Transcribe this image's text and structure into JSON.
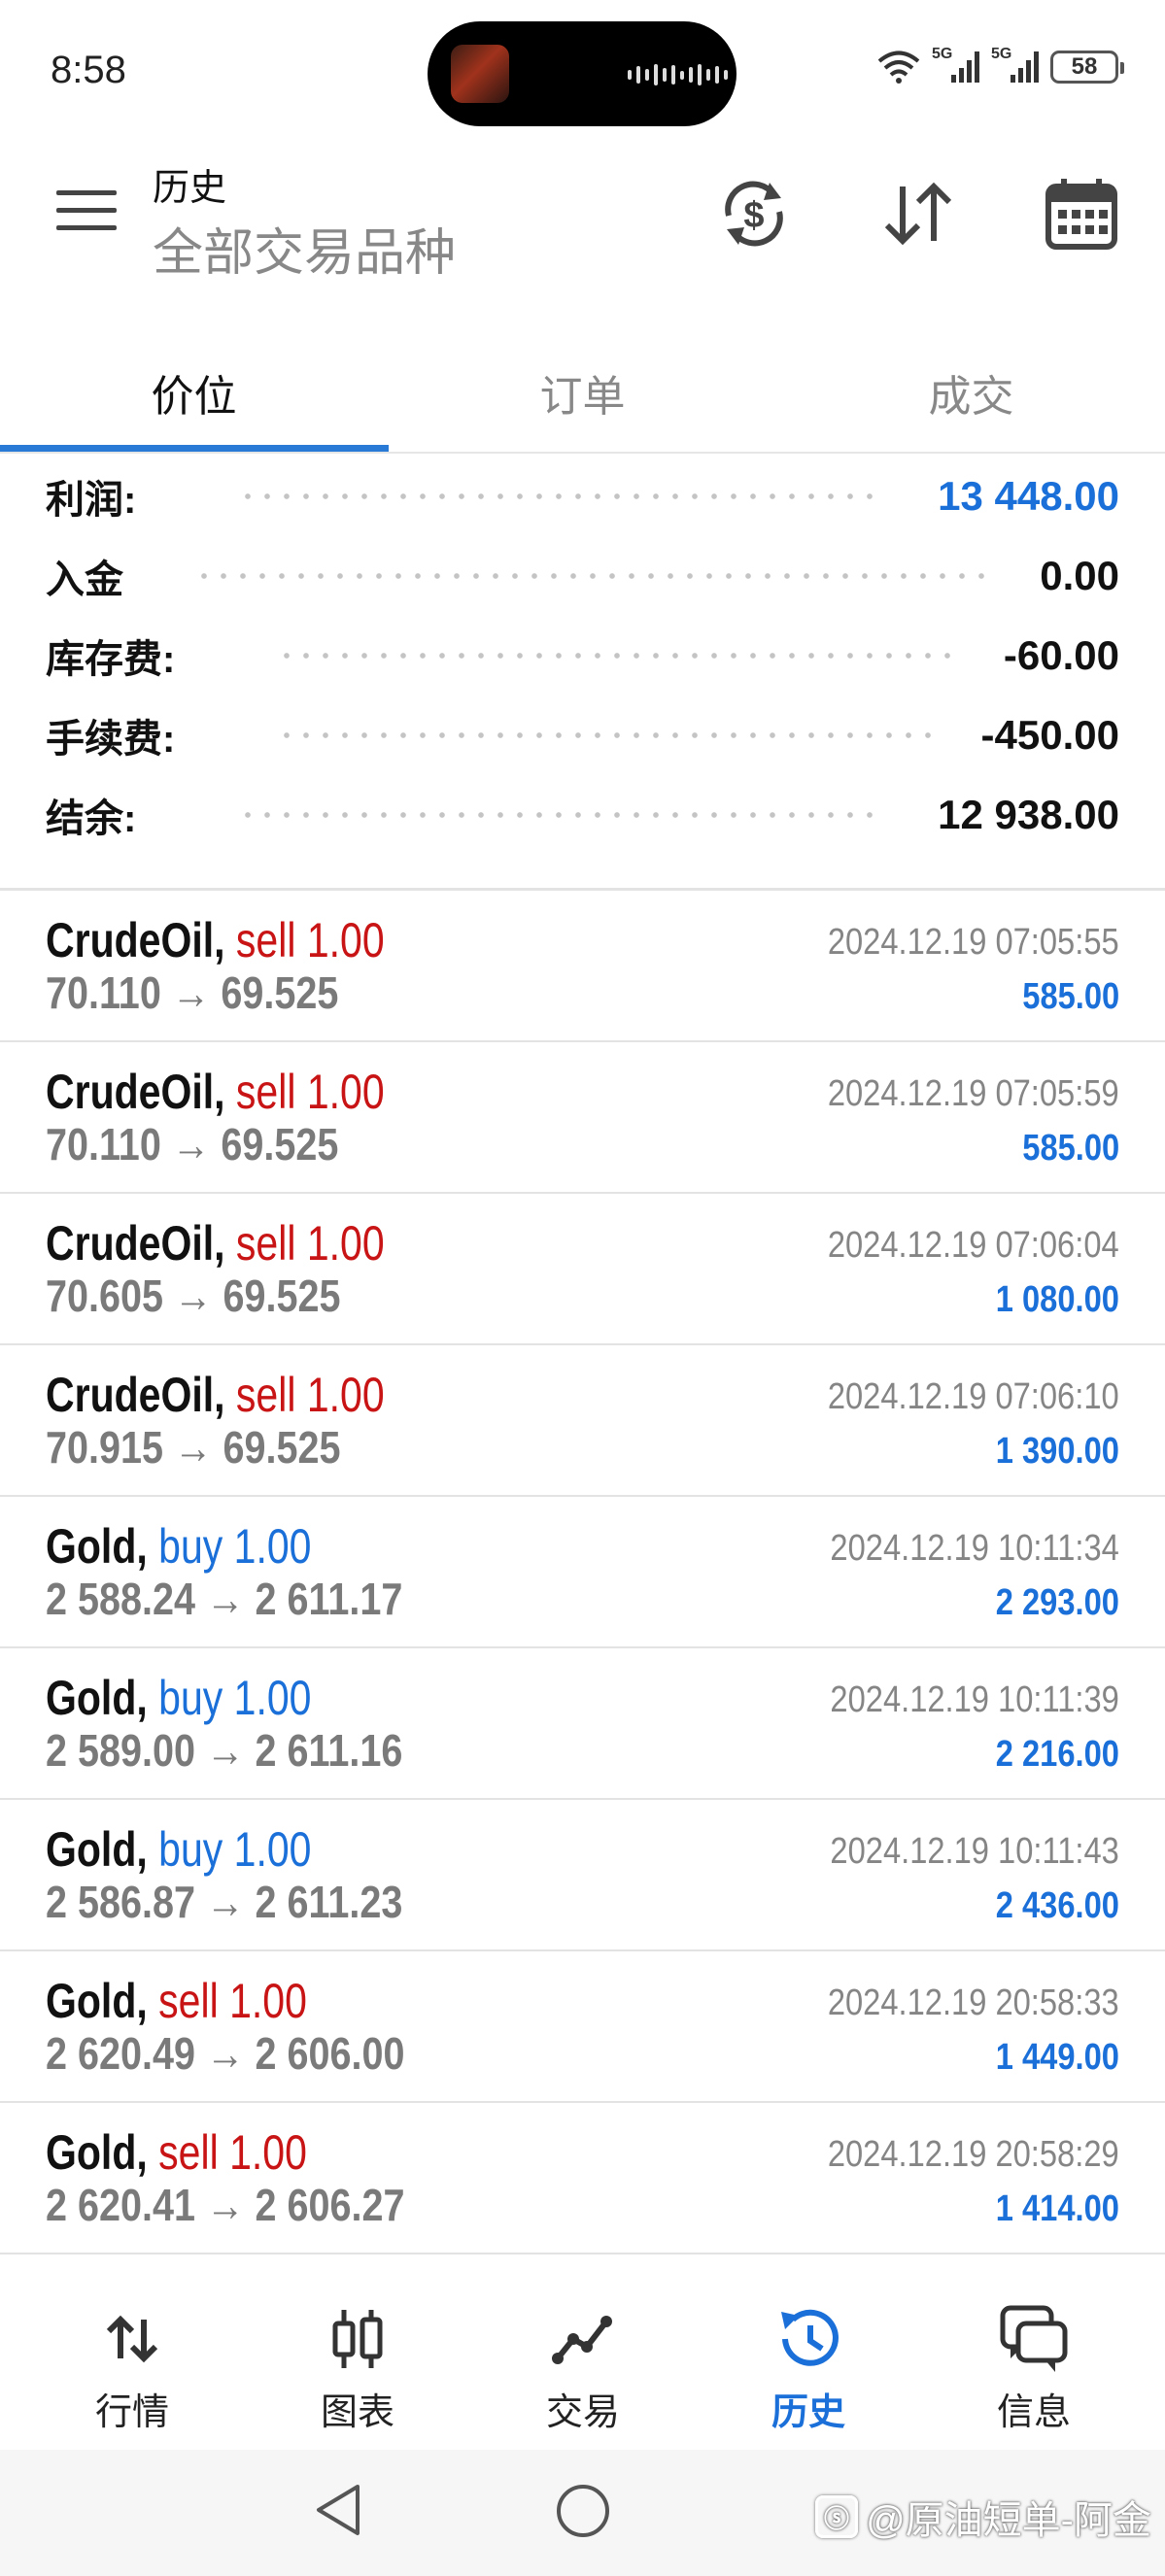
{
  "status_bar": {
    "time": "8:58",
    "network_1": "5G",
    "network_2": "5G",
    "battery": "58",
    "icons": [
      "wifi-icon",
      "signal-icon",
      "signal-icon",
      "battery-icon"
    ]
  },
  "header": {
    "title": "历史",
    "subtitle": "全部交易品种",
    "actions": [
      "currency-exchange-icon",
      "sort-icon",
      "calendar-icon"
    ]
  },
  "tabs": [
    {
      "label": "价位",
      "active": true
    },
    {
      "label": "订单",
      "active": false
    },
    {
      "label": "成交",
      "active": false
    }
  ],
  "summary": [
    {
      "label": "利润:",
      "value": "13 448.00",
      "highlight": true
    },
    {
      "label": "入金",
      "value": "0.00",
      "highlight": false
    },
    {
      "label": "库存费:",
      "value": "-60.00",
      "highlight": false
    },
    {
      "label": "手续费:",
      "value": "-450.00",
      "highlight": false
    },
    {
      "label": "结余:",
      "value": "12 938.00",
      "highlight": false
    }
  ],
  "deals": [
    {
      "symbol": "CrudeOil,",
      "side": "sell 1.00",
      "type": "sell",
      "prices": "70.110 → 69.525",
      "time": "2024.12.19 07:05:55",
      "profit": "585.00"
    },
    {
      "symbol": "CrudeOil,",
      "side": "sell 1.00",
      "type": "sell",
      "prices": "70.110 → 69.525",
      "time": "2024.12.19 07:05:59",
      "profit": "585.00"
    },
    {
      "symbol": "CrudeOil,",
      "side": "sell 1.00",
      "type": "sell",
      "prices": "70.605 → 69.525",
      "time": "2024.12.19 07:06:04",
      "profit": "1 080.00"
    },
    {
      "symbol": "CrudeOil,",
      "side": "sell 1.00",
      "type": "sell",
      "prices": "70.915 → 69.525",
      "time": "2024.12.19 07:06:10",
      "profit": "1 390.00"
    },
    {
      "symbol": "Gold,",
      "side": "buy 1.00",
      "type": "buy",
      "prices": "2 588.24 → 2 611.17",
      "time": "2024.12.19 10:11:34",
      "profit": "2 293.00"
    },
    {
      "symbol": "Gold,",
      "side": "buy 1.00",
      "type": "buy",
      "prices": "2 589.00 → 2 611.16",
      "time": "2024.12.19 10:11:39",
      "profit": "2 216.00"
    },
    {
      "symbol": "Gold,",
      "side": "buy 1.00",
      "type": "buy",
      "prices": "2 586.87 → 2 611.23",
      "time": "2024.12.19 10:11:43",
      "profit": "2 436.00"
    },
    {
      "symbol": "Gold,",
      "side": "sell 1.00",
      "type": "sell",
      "prices": "2 620.49 → 2 606.00",
      "time": "2024.12.19 20:58:33",
      "profit": "1 449.00"
    },
    {
      "symbol": "Gold,",
      "side": "sell 1.00",
      "type": "sell",
      "prices": "2 620.41 → 2 606.27",
      "time": "2024.12.19 20:58:29",
      "profit": "1 414.00"
    }
  ],
  "bottom_nav": [
    {
      "label": "行情",
      "icon": "quotes-icon",
      "active": false
    },
    {
      "label": "图表",
      "icon": "chart-icon",
      "active": false
    },
    {
      "label": "交易",
      "icon": "trade-icon",
      "active": false
    },
    {
      "label": "历史",
      "icon": "history-icon",
      "active": true
    },
    {
      "label": "信息",
      "icon": "messages-icon",
      "active": false
    }
  ],
  "watermark": "@原油短单-阿金",
  "colors": {
    "accent": "#1a6fd8",
    "sell": "#c81414",
    "tab_indicator": "#2979d6"
  }
}
